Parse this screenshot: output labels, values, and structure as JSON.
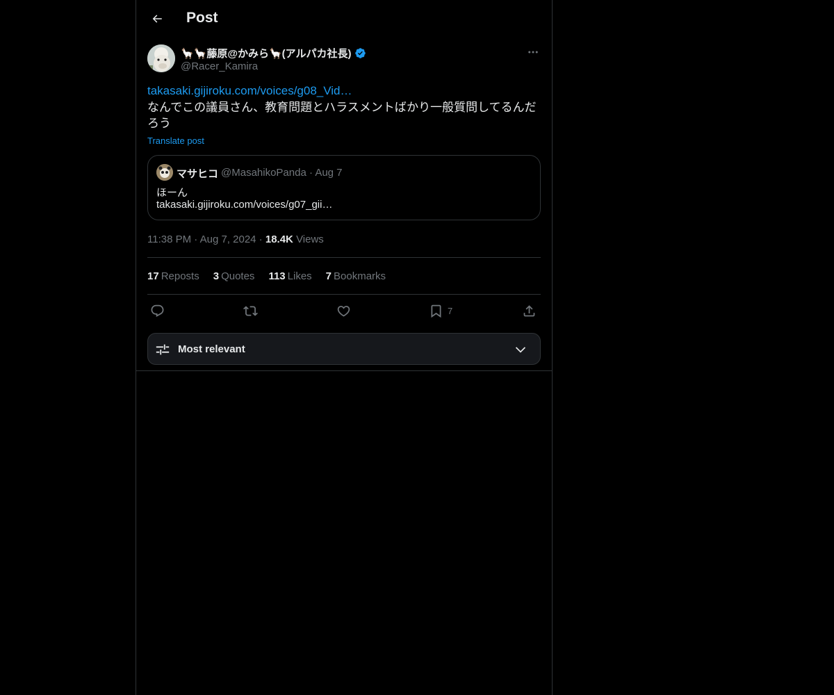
{
  "header": {
    "title": "Post"
  },
  "post": {
    "author_name": "🦙🦙藤原@かみら🦙(アルパカ社長)",
    "author_handle": "@Racer_Kamira",
    "link": "takasaki.gijiroku.com/voices/g08_Vid…",
    "text": "なんでこの議員さん、教育問題とハラスメントばかり一般質問してるんだろう",
    "translate_label": "Translate post",
    "quote": {
      "name": "マサヒコ",
      "handle": "@MasahikoPanda",
      "date": "Aug 7",
      "text": "ほーん",
      "link": "takasaki.gijiroku.com/voices/g07_gii…"
    },
    "time": "11:38 PM",
    "date": "Aug 7, 2024",
    "views_count": "18.4K",
    "views_label": "Views",
    "stats": [
      {
        "count": "17",
        "label": "Reposts"
      },
      {
        "count": "3",
        "label": "Quotes"
      },
      {
        "count": "113",
        "label": "Likes"
      },
      {
        "count": "7",
        "label": "Bookmarks"
      }
    ],
    "bookmark_count": "7"
  },
  "sort": {
    "label": "Most relevant"
  },
  "icons": [
    "back-arrow-icon",
    "verified-badge-icon",
    "more-icon",
    "reply-icon",
    "repost-icon",
    "like-icon",
    "bookmark-icon",
    "share-icon",
    "sliders-icon",
    "chevron-down-icon"
  ],
  "colors": {
    "accent": "#1d9bf0",
    "text": "#e7e9ea",
    "muted": "#71767b",
    "border": "#2f3336",
    "background": "#000000"
  }
}
